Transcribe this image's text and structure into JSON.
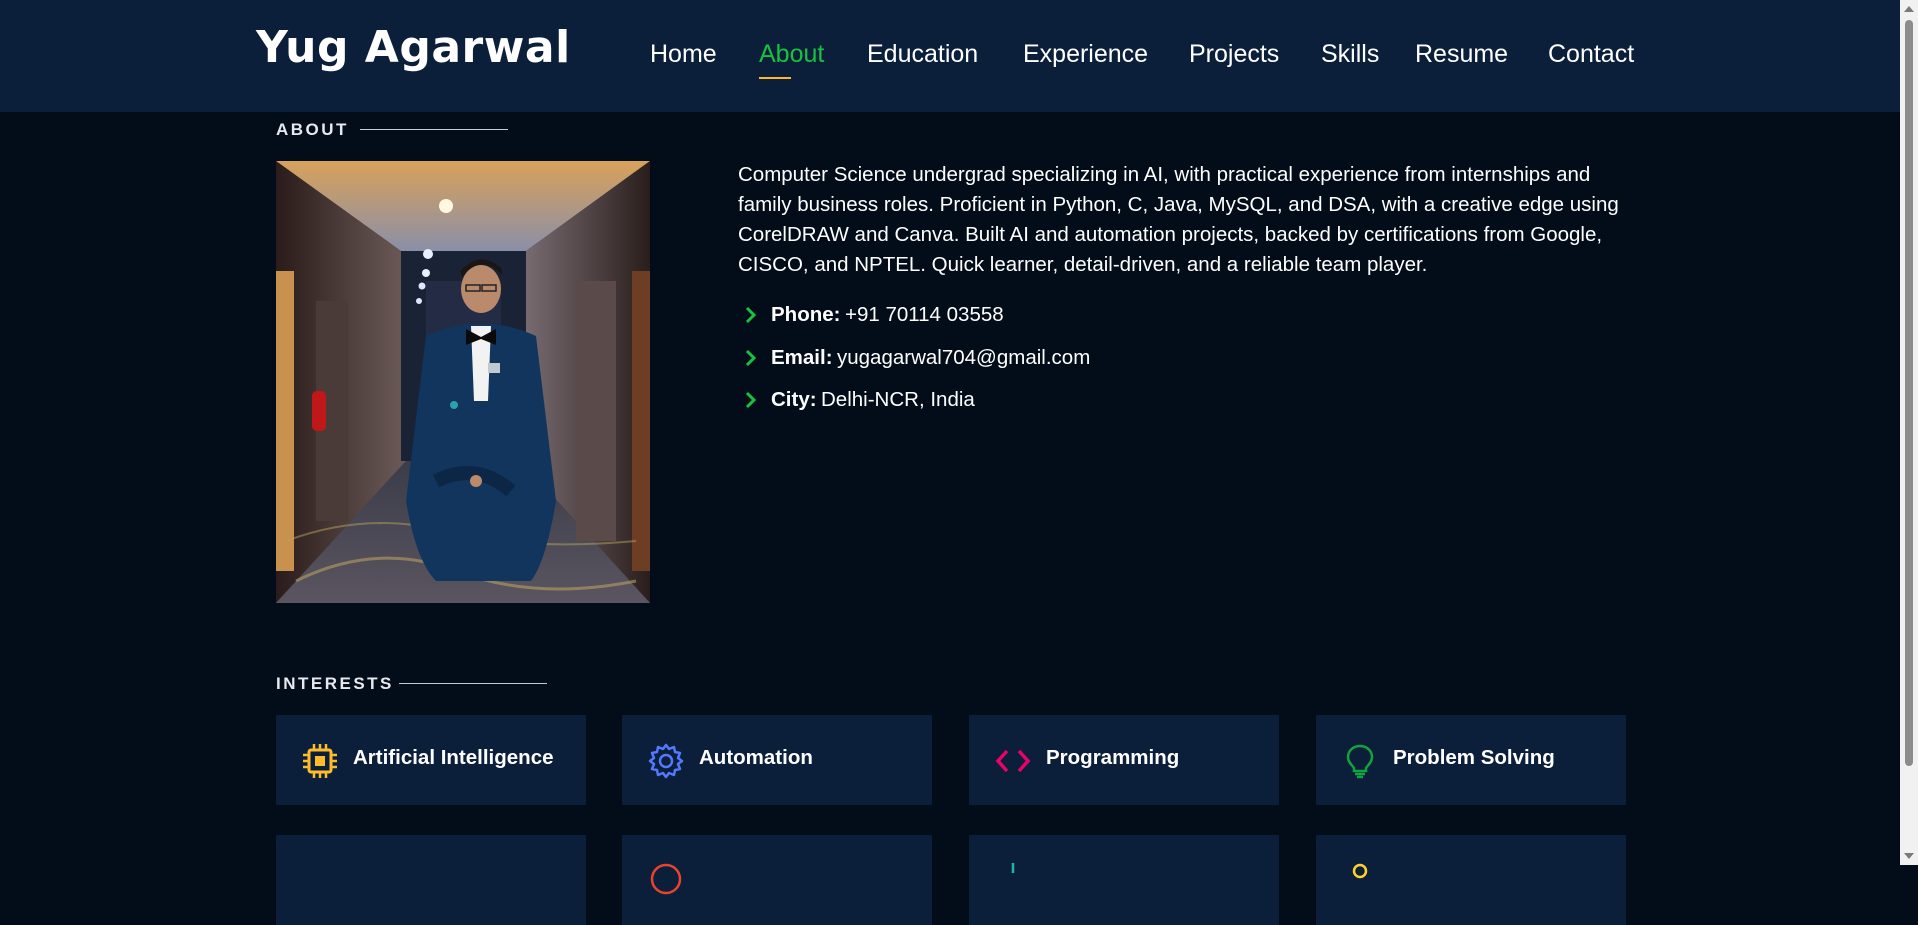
{
  "header": {
    "logo": "Yug Agarwal",
    "nav": [
      {
        "label": "Home",
        "active": false
      },
      {
        "label": "About",
        "active": true
      },
      {
        "label": "Education",
        "active": false
      },
      {
        "label": "Experience",
        "active": false
      },
      {
        "label": "Projects",
        "active": false
      },
      {
        "label": "Skills",
        "active": false
      },
      {
        "label": "Resume",
        "active": false
      },
      {
        "label": "Contact",
        "active": false
      }
    ]
  },
  "about": {
    "title": "ABOUT",
    "description": "Computer Science undergrad specializing in AI, with practical experience from internships and family business roles. Proficient in Python, C, Java, MySQL, and DSA, with a creative edge using CorelDRAW and Canva. Built AI and automation projects, backed by certifications from Google, CISCO, and NPTEL. Quick learner, detail-driven, and a reliable team player.",
    "phone_label": "Phone:",
    "phone": "+91 70114 03558",
    "email_label": "Email:",
    "email": "yugagarwal704@gmail.com",
    "city_label": "City:",
    "city": "Delhi-NCR, India"
  },
  "interests": {
    "title": "INTERESTS",
    "items": [
      {
        "label": "Artificial Intelligence",
        "icon": "cpu-chip-icon",
        "color": "#ffbb2c"
      },
      {
        "label": "Automation",
        "icon": "gear-icon",
        "color": "#5578ff"
      },
      {
        "label": "Programming",
        "icon": "code-icon",
        "color": "#e80368"
      },
      {
        "label": "Problem Solving",
        "icon": "lightbulb-icon",
        "color": "#11a33b"
      }
    ]
  },
  "colors": {
    "accent": "#18c13f",
    "underline": "#ffb727",
    "header_bg": "#0b1f3a",
    "page_bg": "#020d19"
  }
}
